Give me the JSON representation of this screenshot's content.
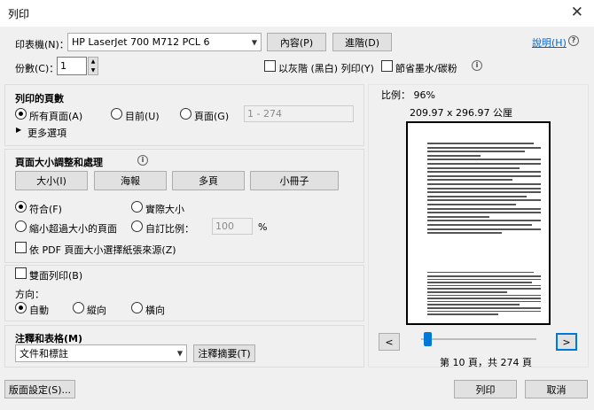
{
  "window": {
    "title": "列印",
    "close_glyph": "✕"
  },
  "printer": {
    "label": "印表機(N)：",
    "selected": "HP LaserJet 700 M712 PCL 6",
    "properties_btn": "內容(P)",
    "advanced_btn": "進階(D)",
    "help_link": "說明(H)",
    "help_icon": "?"
  },
  "copies": {
    "label": "份數(C)：",
    "value": "1",
    "grayscale_label": "以灰階 (黑白) 列印(Y)",
    "save_ink_label": "節省墨水/碳粉",
    "info_glyph": "i"
  },
  "pages_section": {
    "title": "列印的頁數",
    "all": "所有頁面(A)",
    "current": "目前(U)",
    "pages": "頁面(G)",
    "range_placeholder": "1 - 274",
    "more_options": "更多選項",
    "more_glyph": "▶"
  },
  "size_section": {
    "title": "頁面大小調整和處理",
    "info_glyph": "i",
    "btn_size": "大小(I)",
    "btn_poster": "海報",
    "btn_multiple": "多頁",
    "btn_booklet": "小冊子",
    "fit": "符合(F)",
    "actual": "實際大小",
    "shrink": "縮小超過大小的頁面",
    "custom": "自訂比例：",
    "custom_value": "100",
    "percent": "%",
    "choose_paper": "依 PDF 頁面大小選擇紙張來源(Z)"
  },
  "duplex": {
    "label": "雙面列印(B)"
  },
  "orientation": {
    "label": "方向：",
    "auto": "自動",
    "portrait": "縱向",
    "landscape": "橫向"
  },
  "comments": {
    "title": "注釋和表格(M)",
    "selected": "文件和標註",
    "summary_btn": "注釋摘要(T)"
  },
  "preview": {
    "scale": "比例： 96%",
    "dimensions": "209.97 x 296.97 公厘",
    "prev_glyph": "<",
    "next_glyph": ">",
    "page_info": "第 10 頁，共 274 頁"
  },
  "footer": {
    "page_setup": "版面設定(S)...",
    "print": "列印",
    "cancel": "取消"
  }
}
